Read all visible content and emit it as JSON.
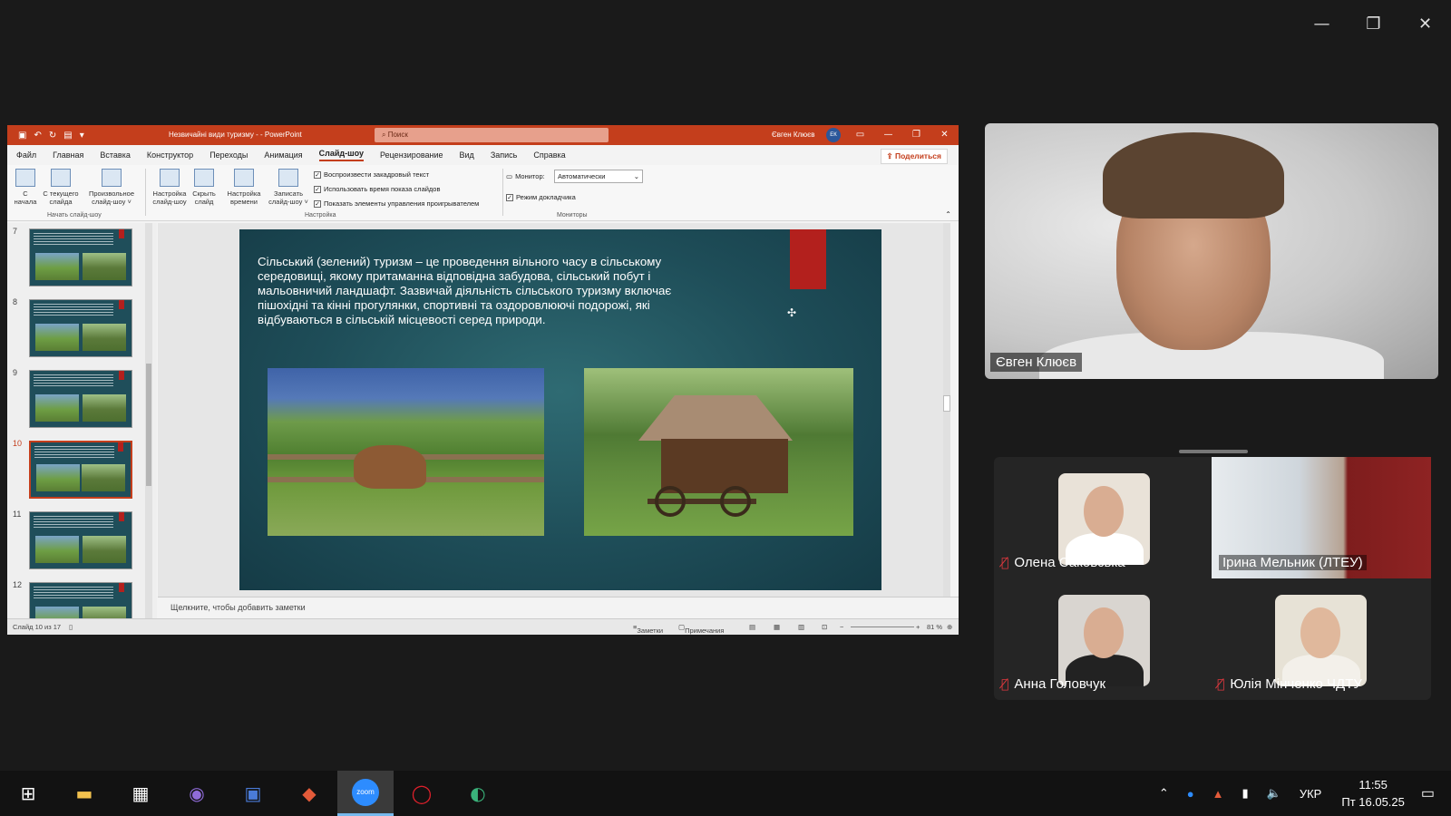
{
  "window_controls": [
    "minimize-icon",
    "restore-icon",
    "close-icon"
  ],
  "powerpoint": {
    "doc_title": "Незвичайні види туризму -  - PowerPoint",
    "search_placeholder": "Поиск",
    "user_name": "Євген Клюєв",
    "user_initials": "ЕК",
    "menu": [
      "Файл",
      "Главная",
      "Вставка",
      "Конструктор",
      "Переходы",
      "Анимация",
      "Слайд-шоу",
      "Рецензирование",
      "Вид",
      "Запись",
      "Справка"
    ],
    "active_menu": "Слайд-шоу",
    "share_label": "Поделиться",
    "ribbon": {
      "from_start": [
        "С",
        "начала"
      ],
      "from_current": [
        "С текущего",
        "слайда"
      ],
      "custom_show": [
        "Произвольное",
        "слайд-шоу ˅"
      ],
      "group_start": "Начать слайд-шоу",
      "setup_show": [
        "Настройка",
        "слайд-шоу"
      ],
      "hide_slide": [
        "Скрыть",
        "слайд"
      ],
      "rehearse": [
        "Настройка",
        "времени"
      ],
      "record": [
        "Записать",
        "слайд-шоу ˅"
      ],
      "checks": [
        "Воспроизвести закадровый текст",
        "Использовать время показа слайдов",
        "Показать элементы управления проигрывателем"
      ],
      "group_setup": "Настройка",
      "monitor_label": "Монитор:",
      "monitor_value": "Автоматически",
      "presenter_view": "Режим докладчика",
      "group_monitors": "Мониторы"
    },
    "slides": [
      {
        "num": "7"
      },
      {
        "num": "8"
      },
      {
        "num": "9"
      },
      {
        "num": "10",
        "active": true
      },
      {
        "num": "11"
      },
      {
        "num": "12"
      }
    ],
    "slide_text": "Сільський (зелений) туризм – це проведення вільного часу в сільському середовищі, якому притаманна відповідна забудова, сільський побут і мальовничий ландшафт. Зазвичай діяльність сільського туризму включає пішохідні та кінні прогулянки, спортивні та оздоровлюючі подорожі, які відбуваються в сільській місцевості серед природи.",
    "notes_placeholder": "Щелкните, чтобы добавить заметки",
    "status": {
      "slide_info": "Слайд 10 из 17",
      "notes": "Заметки",
      "comments": "Примечания",
      "zoom": "81 %"
    }
  },
  "zoom": {
    "speaker_name": "Євген Клюєв",
    "participants": [
      {
        "name": "Олена Саковська",
        "muted": true
      },
      {
        "name": "Ірина Мельник  (ЛТЕУ)",
        "muted": false
      },
      {
        "name": "Анна Головчук",
        "muted": true
      },
      {
        "name": "Юлія Мінченко ЧДТУ",
        "muted": true
      }
    ]
  },
  "taskbar": {
    "apps": [
      "start-icon",
      "file-explorer-icon",
      "calculator-icon",
      "viber-icon",
      "save-disk-icon",
      "chart-app-icon",
      "zoom-app-icon",
      "opera-icon",
      "edge-icon"
    ],
    "active_app": "zoom-app-icon",
    "zoom_label": "zoom",
    "language": "УКР",
    "time": "11:55",
    "date": "Пт 16.05.25"
  }
}
